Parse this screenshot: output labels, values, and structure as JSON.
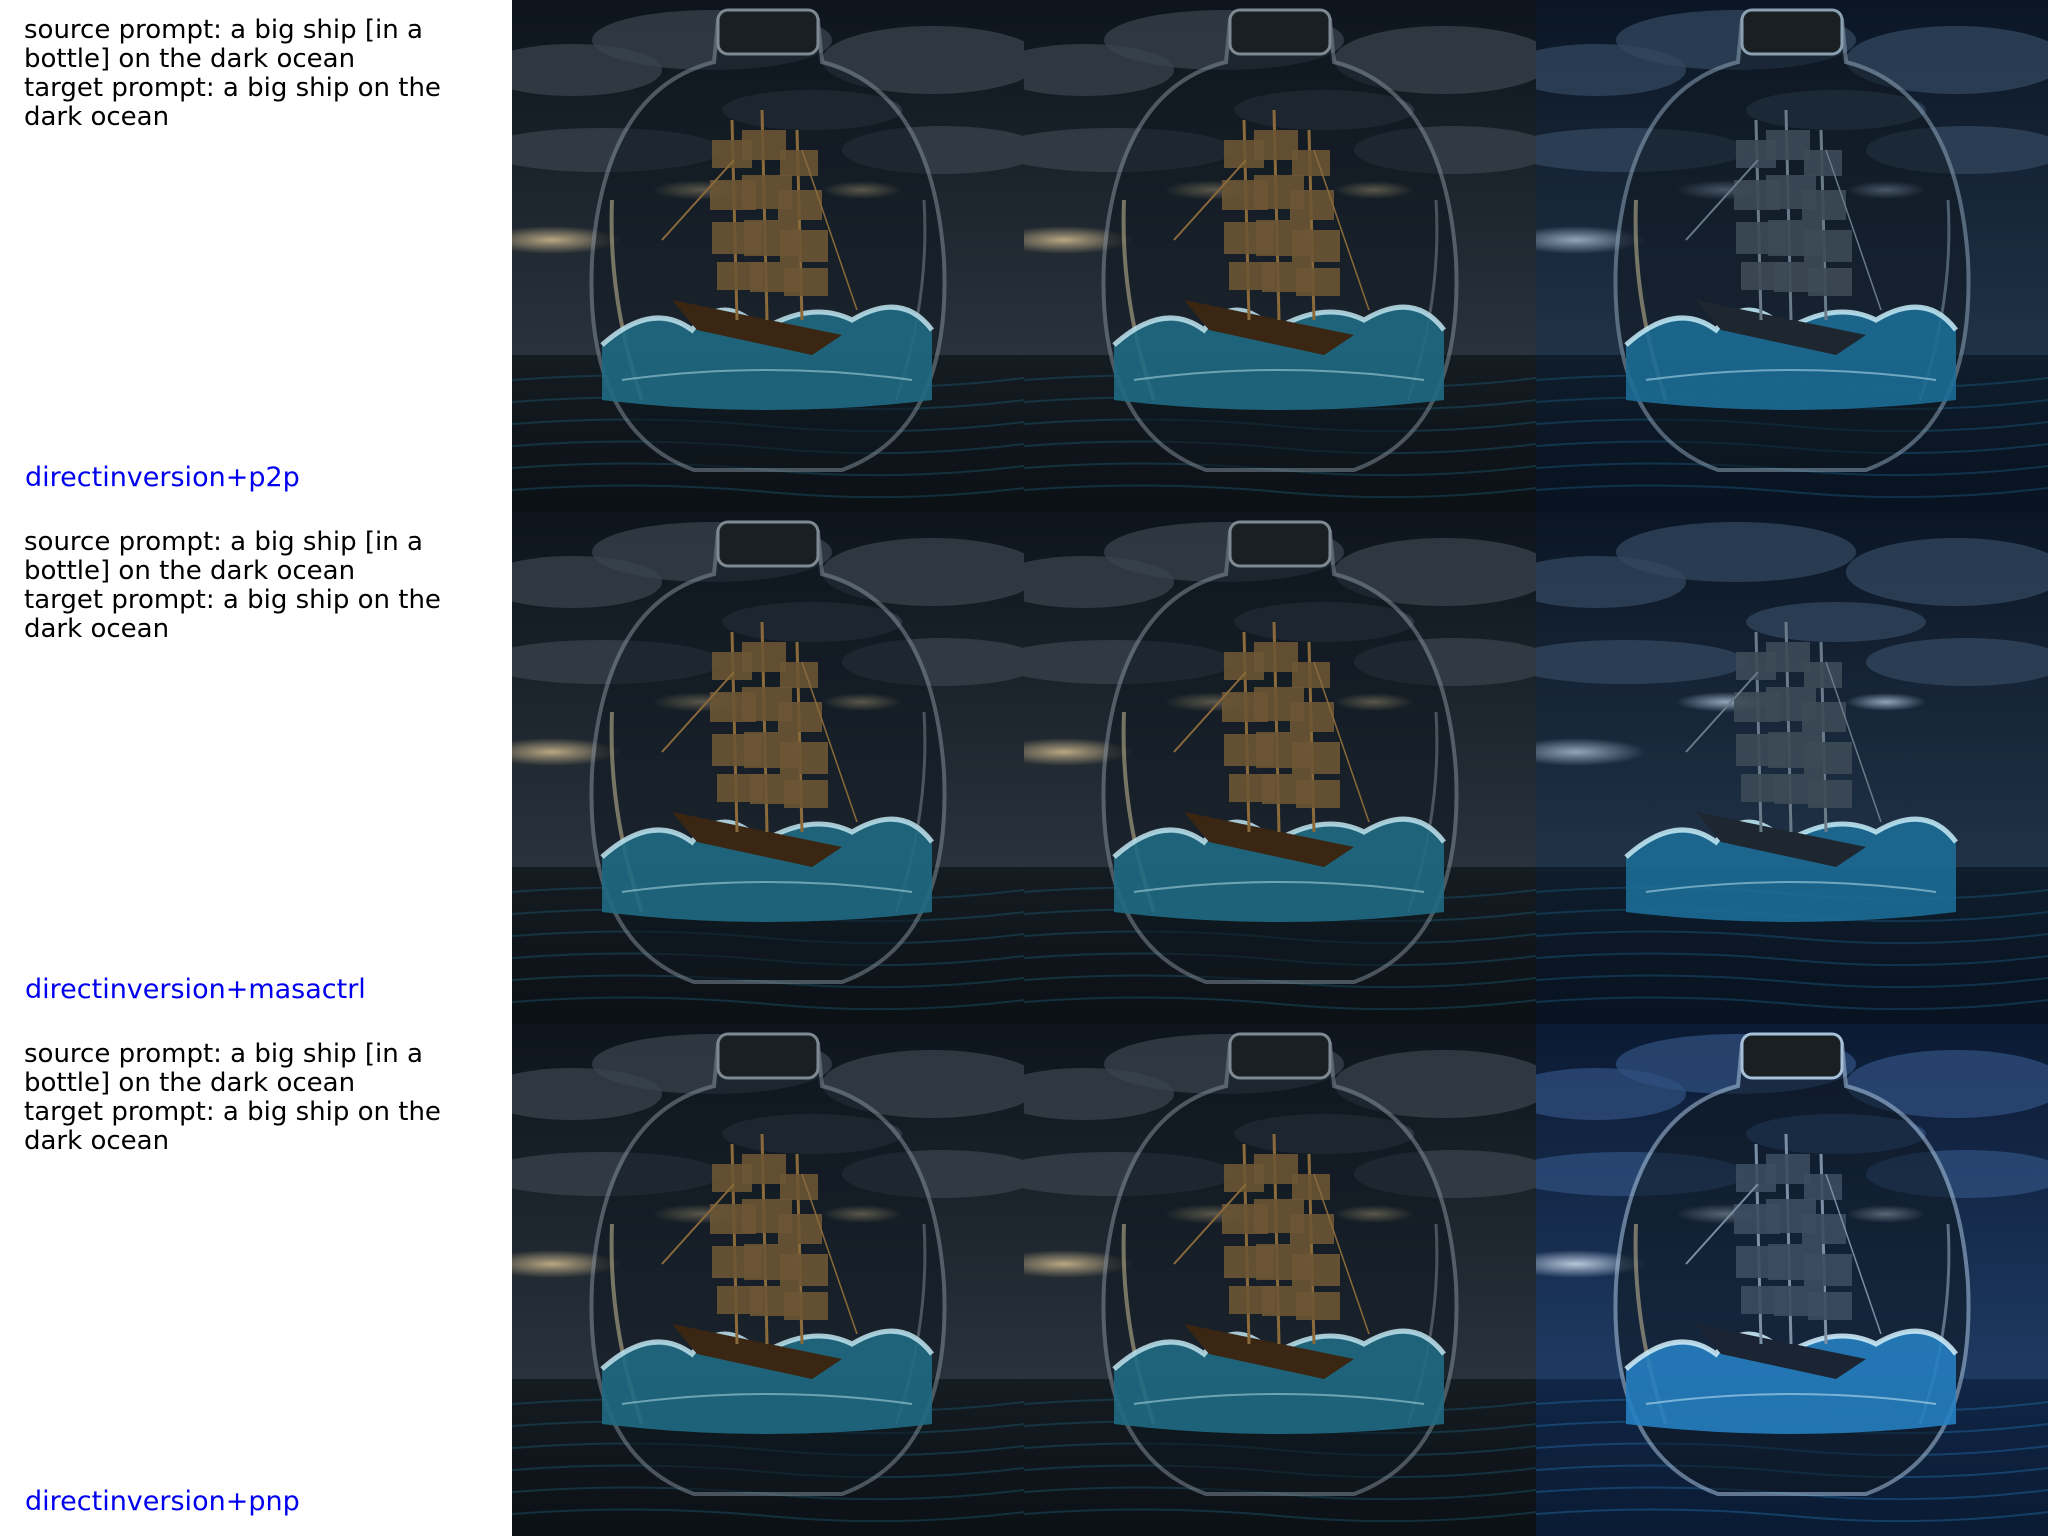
{
  "colors": {
    "method_label": "#0000ee",
    "prompt_text": "#000000",
    "background": "#ffffff"
  },
  "rows": [
    {
      "source_prompt": "source prompt: a big ship [in a bottle] on the dark ocean",
      "target_prompt": "target prompt: a big ship on the dark ocean",
      "method": "directinversion+p2p",
      "images": [
        {
          "tone": "warm",
          "bottle": true
        },
        {
          "tone": "warm",
          "bottle": true
        },
        {
          "tone": "blue",
          "bottle": true
        }
      ]
    },
    {
      "source_prompt": "source prompt: a big ship [in a bottle] on the dark ocean",
      "target_prompt": "target prompt: a big ship on the dark ocean",
      "method": "directinversion+masactrl",
      "images": [
        {
          "tone": "warm",
          "bottle": true
        },
        {
          "tone": "warm",
          "bottle": true
        },
        {
          "tone": "blue",
          "bottle": false
        }
      ]
    },
    {
      "source_prompt": "source prompt: a big ship [in a bottle] on the dark ocean",
      "target_prompt": "target prompt: a big ship on the dark ocean",
      "method": "directinversion+pnp",
      "images": [
        {
          "tone": "warm",
          "bottle": true
        },
        {
          "tone": "warm",
          "bottle": true
        },
        {
          "tone": "deepblue",
          "bottle": true
        }
      ]
    }
  ]
}
